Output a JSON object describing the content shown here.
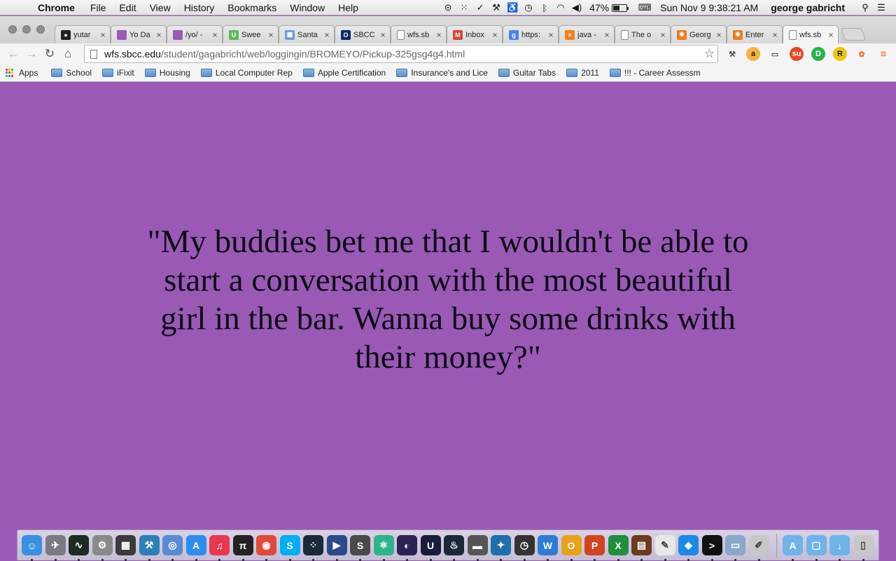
{
  "menubar": {
    "app_name": "Chrome",
    "menus": [
      "File",
      "Edit",
      "View",
      "History",
      "Bookmarks",
      "Window",
      "Help"
    ],
    "battery_percent": "47%",
    "battery_level": 0.47,
    "clock": "Sun Nov 9  9:38:21 AM",
    "user": "george gabricht"
  },
  "tabs": [
    {
      "title": "yutar",
      "favicon": "github-icon",
      "color": "#222222",
      "glyph": "●"
    },
    {
      "title": "Yo Da",
      "favicon": "purple-square-icon",
      "color": "#9b59b6",
      "glyph": ""
    },
    {
      "title": "/yo/ -",
      "favicon": "purple-square-icon",
      "color": "#9b59b6",
      "glyph": ""
    },
    {
      "title": "Swee",
      "favicon": "upwork-icon",
      "color": "#5cb85c",
      "glyph": "U"
    },
    {
      "title": "Santa",
      "favicon": "image-icon",
      "color": "#6aa0d8",
      "glyph": "▦"
    },
    {
      "title": "SBCC",
      "favicon": "sbcc-icon",
      "color": "#0a2a66",
      "glyph": "O"
    },
    {
      "title": "wfs.sb",
      "favicon": "page-icon",
      "color": "#ffffff",
      "glyph": ""
    },
    {
      "title": "Inbox",
      "favicon": "gmail-icon",
      "color": "#d44638",
      "glyph": "M"
    },
    {
      "title": "https:",
      "favicon": "google-icon",
      "color": "#4a86e8",
      "glyph": "g"
    },
    {
      "title": "java -",
      "favicon": "stackoverflow-icon",
      "color": "#f48024",
      "glyph": "≡"
    },
    {
      "title": "The o",
      "favicon": "page-icon",
      "color": "#ffffff",
      "glyph": ""
    },
    {
      "title": "Georg",
      "favicon": "puzzle-icon",
      "color": "#e67e22",
      "glyph": "✱"
    },
    {
      "title": "Enter",
      "favicon": "puzzle-icon",
      "color": "#e67e22",
      "glyph": "✱"
    },
    {
      "title": "wfs.sb",
      "favicon": "page-icon",
      "color": "#ffffff",
      "glyph": ""
    }
  ],
  "toolbar": {
    "url_host": "wfs.sbcc.edu",
    "url_path": "/student/gagabricht/web/loggingin/BROMEYO/Pickup-325gsg4g4.html"
  },
  "bookmarks": {
    "apps_label": "Apps",
    "items": [
      "School",
      "iFixit",
      "Housing",
      "Local Computer Rep",
      "Apple Certification",
      "Insurance's and Lice",
      "Guitar Tabs",
      "2011",
      "!!! - Career Assessm"
    ]
  },
  "page": {
    "background": "#9b59b6",
    "quote": "\"My buddies bet me that I wouldn't be able to start a conversation with the most beautiful girl in the bar. Wanna buy some drinks with their money?\""
  },
  "dock": {
    "apps": [
      {
        "name": "finder-icon",
        "color": "#3a8fe0",
        "glyph": "☺"
      },
      {
        "name": "launchpad-icon",
        "color": "#7a7a85",
        "glyph": "✈"
      },
      {
        "name": "activity-monitor-icon",
        "color": "#1d2b22",
        "glyph": "∿"
      },
      {
        "name": "system-preferences-icon",
        "color": "#8a8a8a",
        "glyph": "⚙"
      },
      {
        "name": "photo-booth-icon",
        "color": "#3b3b3b",
        "glyph": "▦"
      },
      {
        "name": "xcode-icon",
        "color": "#2c7fb8",
        "glyph": "⚒"
      },
      {
        "name": "network-utility-icon",
        "color": "#5a8bd0",
        "glyph": "◎"
      },
      {
        "name": "app-store-icon",
        "color": "#2b8df0",
        "glyph": "A"
      },
      {
        "name": "itunes-icon",
        "color": "#e8384f",
        "glyph": "♫"
      },
      {
        "name": "pi-icon",
        "color": "#222222",
        "glyph": "π"
      },
      {
        "name": "chrome-icon",
        "color": "#dd4b39",
        "glyph": "◉"
      },
      {
        "name": "skype-icon",
        "color": "#00aff0",
        "glyph": "S"
      },
      {
        "name": "fitbit-icon",
        "color": "#1a2a3a",
        "glyph": "⁘"
      },
      {
        "name": "quicktime-icon",
        "color": "#2a4a8a",
        "glyph": "▶"
      },
      {
        "name": "sublime-text-icon",
        "color": "#4a4a4a",
        "glyph": "S"
      },
      {
        "name": "atom-icon",
        "color": "#2fb38b",
        "glyph": "⚛"
      },
      {
        "name": "eclipse-icon",
        "color": "#2c2255",
        "glyph": "◐"
      },
      {
        "name": "unreal-icon",
        "color": "#1b1b3b",
        "glyph": "U"
      },
      {
        "name": "steam-icon",
        "color": "#1b2838",
        "glyph": "♨"
      },
      {
        "name": "disk-icon",
        "color": "#555555",
        "glyph": "▬"
      },
      {
        "name": "xcode-instruments-icon",
        "color": "#1f6fa8",
        "glyph": "✦"
      },
      {
        "name": "clock-icon",
        "color": "#333333",
        "glyph": "◷"
      },
      {
        "name": "word-icon",
        "color": "#2b7cd3",
        "glyph": "W"
      },
      {
        "name": "outlook-icon",
        "color": "#e8a21a",
        "glyph": "O"
      },
      {
        "name": "powerpoint-icon",
        "color": "#d04423",
        "glyph": "P"
      },
      {
        "name": "excel-icon",
        "color": "#1f8e3d",
        "glyph": "X"
      },
      {
        "name": "book-icon",
        "color": "#6b3a1f",
        "glyph": "▤"
      },
      {
        "name": "textedit-icon",
        "color": "#e8e8e8",
        "glyph": "✎"
      },
      {
        "name": "safari-icon",
        "color": "#1e88e5",
        "glyph": "◈"
      },
      {
        "name": "terminal-icon",
        "color": "#111111",
        "glyph": ">"
      },
      {
        "name": "preview-icon",
        "color": "#8aa8c8",
        "glyph": "▭"
      },
      {
        "name": "script-editor-icon",
        "color": "#c8c8c8",
        "glyph": "✐"
      }
    ],
    "stacks": [
      {
        "name": "applications-folder-icon",
        "color": "#6fb3e8",
        "glyph": "A"
      },
      {
        "name": "documents-folder-icon",
        "color": "#6fb3e8",
        "glyph": "▢"
      },
      {
        "name": "downloads-folder-icon",
        "color": "#6fb3e8",
        "glyph": "↓"
      },
      {
        "name": "trash-icon",
        "color": "#c8c8c8",
        "glyph": "▯"
      }
    ]
  }
}
